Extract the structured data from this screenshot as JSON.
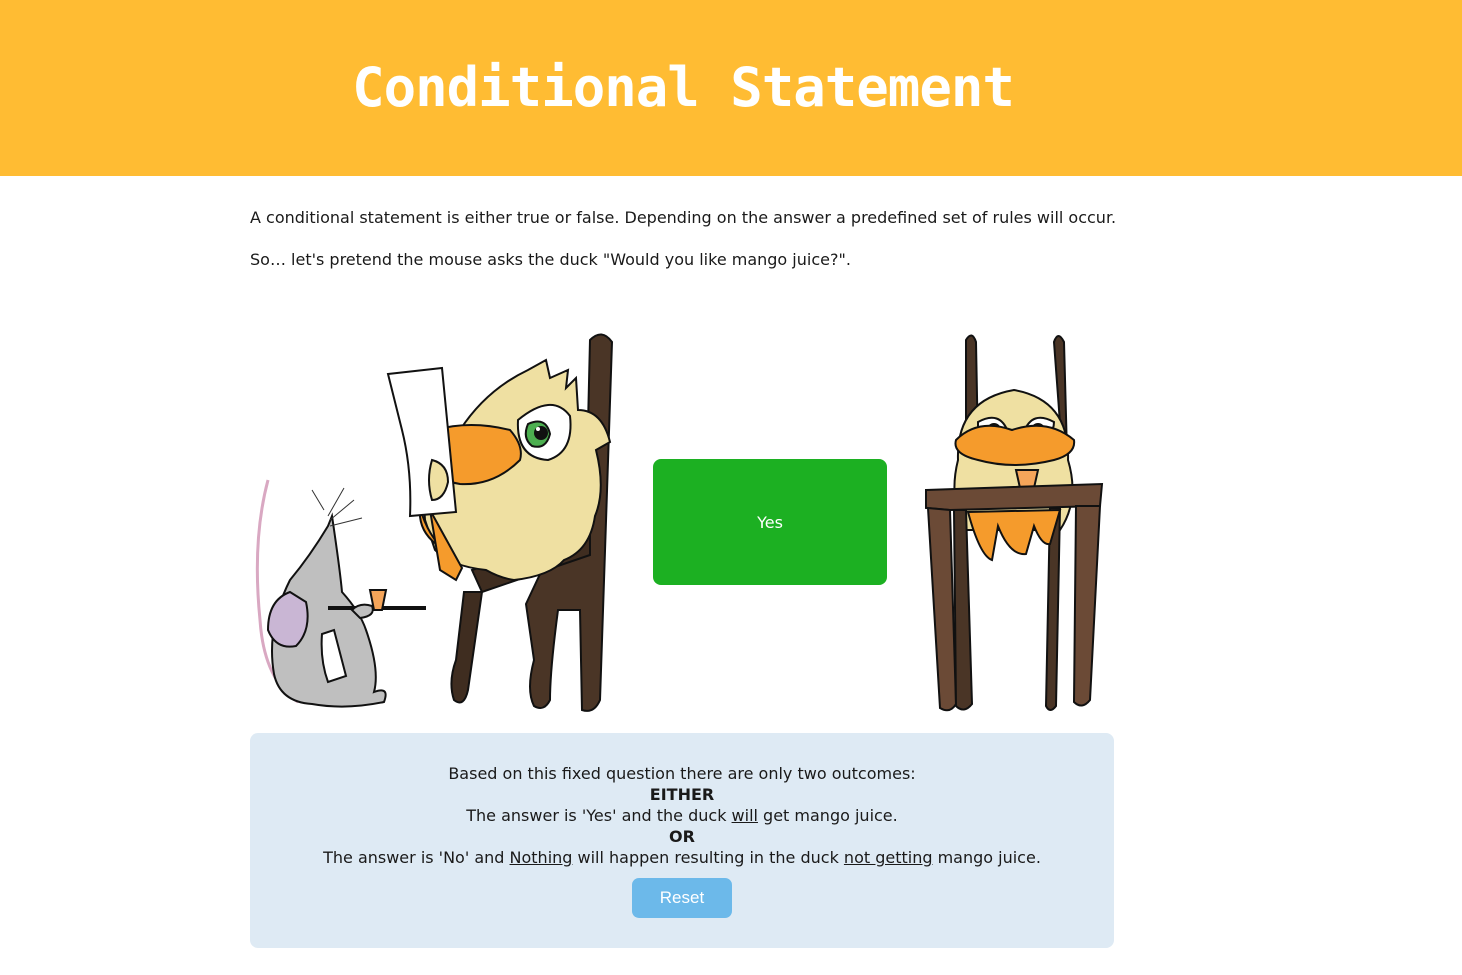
{
  "header": {
    "title": "Conditional Statement",
    "bg_color": "#ffbc33"
  },
  "intro": {
    "paragraph1": "A conditional statement is either true or false. Depending on the answer a predefined set of rules will occur.",
    "paragraph2": "So… let's pretend the mouse asks the duck \"Would you like mango juice?\"."
  },
  "scene": {
    "left_illustration": "mouse-serving-juice-to-duck-reading",
    "right_illustration": "duck-at-table-with-juice",
    "answer_button": {
      "label": "Yes",
      "color": "#1cb022"
    }
  },
  "outcomes": {
    "intro": "Based on this fixed question there are only two outcomes:",
    "either": "EITHER",
    "yes_pre": "The answer is 'Yes' and the duck ",
    "yes_underlined": "will",
    "yes_post": " get mango juice.",
    "or": "OR",
    "no_pre": "The answer is 'No' and ",
    "no_underlined1": "Nothing",
    "no_mid": " will happen resulting in the duck ",
    "no_underlined2": "not getting",
    "no_post": " mango juice.",
    "reset_label": "Reset",
    "box_color": "#deeaf4",
    "reset_color": "#6cb9ea"
  }
}
